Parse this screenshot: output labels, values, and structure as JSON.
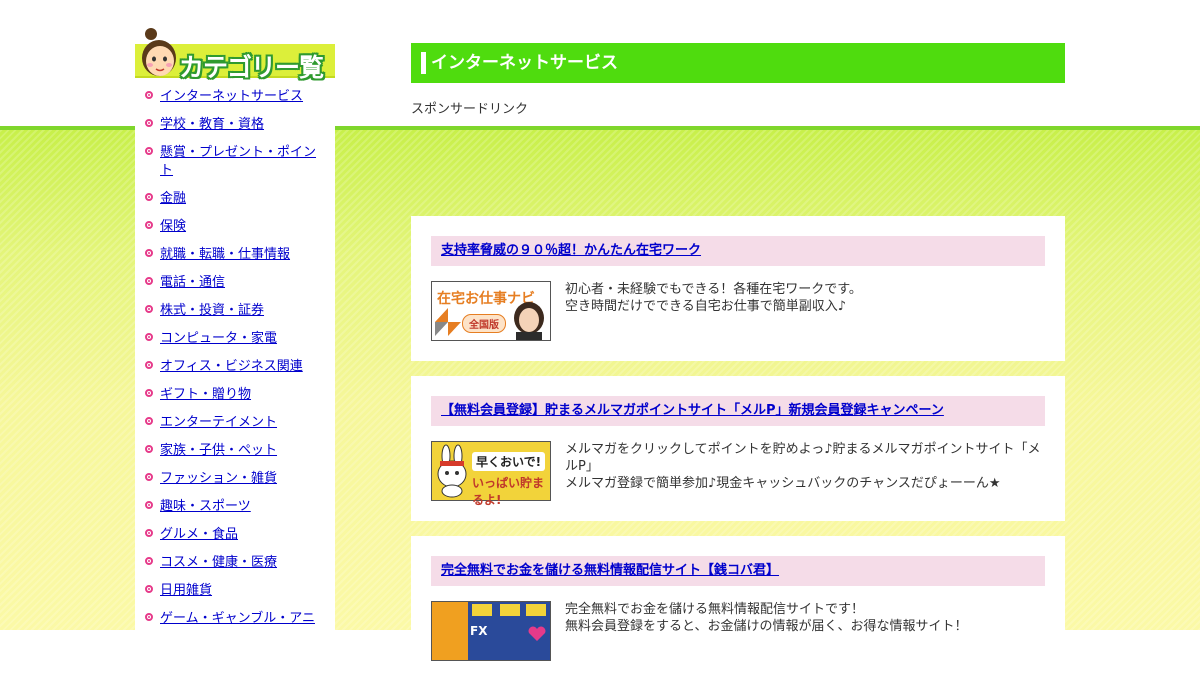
{
  "sidebar": {
    "header_title": "カテゴリー覧",
    "categories": [
      "インターネットサービス",
      "学校・教育・資格",
      "懸賞・プレゼント・ポイント",
      "金融",
      "保険",
      "就職・転職・仕事情報",
      "電話・通信",
      "株式・投資・証券",
      "コンピュータ・家電",
      "オフィス・ビジネス関連",
      "ギフト・贈り物",
      "エンターテイメント",
      "家族・子供・ペット",
      "ファッション・雑貨",
      "趣味・スポーツ",
      "グルメ・食品",
      "コスメ・健康・医療",
      "日用雑貨",
      "ゲーム・ギャンブル・アニ"
    ]
  },
  "main": {
    "section_title": "インターネットサービス",
    "sponsor_label": "スポンサードリンク",
    "cards": [
      {
        "title": "支持率脅威の９０％超！かんたん在宅ワーク",
        "thumb_text_top": "在宅お仕事ナビ",
        "thumb_text_bottom": "全国版",
        "desc": [
          "初心者・未経験でもできる！各種在宅ワークです。",
          "空き時間だけでできる自宅お仕事で簡単副収入♪"
        ]
      },
      {
        "title": "【無料会員登録】貯まるメルマガポイントサイト「メルP」新規会員登録キャンペーン",
        "thumb_text_top": "早くおいで!",
        "thumb_text_bottom": "いっぱい貯まるよ!",
        "desc": [
          "メルマガをクリックしてポイントを貯めよっ♪貯まるメルマガポイントサイト「メルP」",
          "メルマガ登録で簡単参加♪現金キャッシュバックのチャンスだぴょーーん★"
        ]
      },
      {
        "title": "完全無料でお金を儲ける無料情報配信サイト【銭コバ君】",
        "thumb_text_top": "FX",
        "thumb_text_bottom": "",
        "desc": [
          "完全無料でお金を儲ける無料情報配信サイトです！",
          "無料会員登録をすると、お金儲けの情報が届く、お得な情報サイト！"
        ]
      }
    ]
  },
  "colors": {
    "accent_green": "#4fdc0e",
    "card_title_bg": "#f5dce8",
    "link": "#0000cc",
    "bullet": "#e63a8a"
  }
}
